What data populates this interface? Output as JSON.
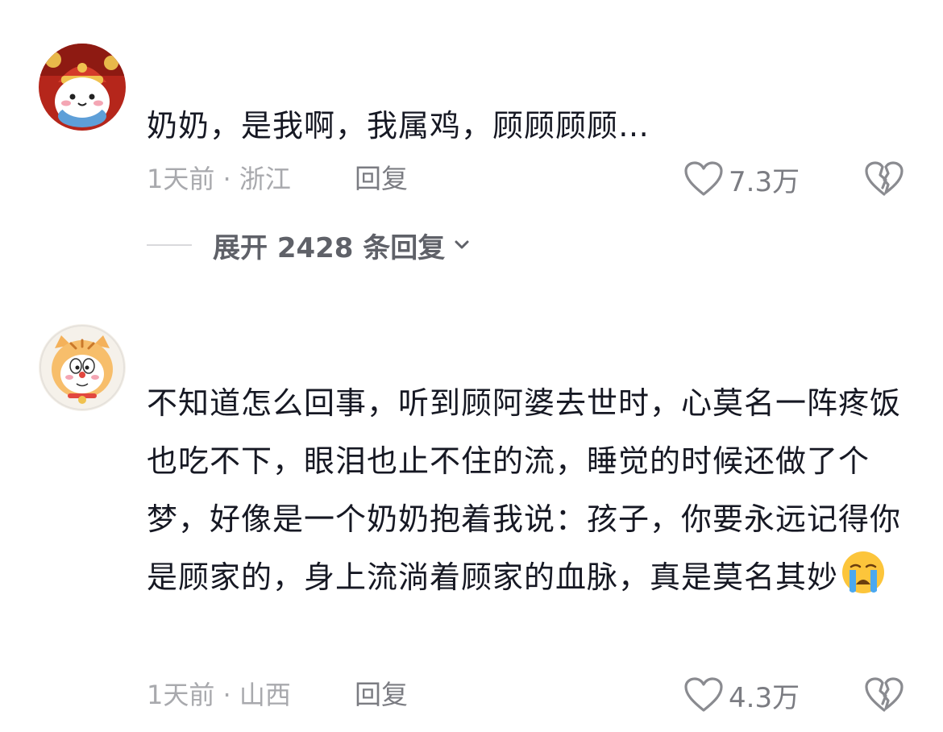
{
  "comments": [
    {
      "avatar_icon": "cartoon-cat-in-red-hat-avatar",
      "text": "奶奶，是我啊，我属鸡，顾顾顾顾…",
      "time": "1天前",
      "location": "浙江",
      "reply_label": "回复",
      "likes": "7.3万",
      "expand_label": "展开 2428 条回复"
    },
    {
      "avatar_icon": "cartoon-tiger-doraemon-avatar",
      "text": "不知道怎么回事，听到顾阿婆去世时，心莫名一阵疼饭也吃不下，眼泪也止不住的流，睡觉的时候还做了个梦，好像是一个奶奶抱着我说：孩子，你要永远记得你是顾家的，身上流淌着顾家的血脉，真是莫名其妙",
      "emoji": "loudly-crying-face-emoji",
      "time": "1天前",
      "location": "山西",
      "reply_label": "回复",
      "likes": "4.3万"
    }
  ],
  "meta_separator": "·",
  "colors": {
    "text_primary": "#161823",
    "text_meta": "#a8a9ad",
    "text_secondary": "#7b7c82"
  }
}
